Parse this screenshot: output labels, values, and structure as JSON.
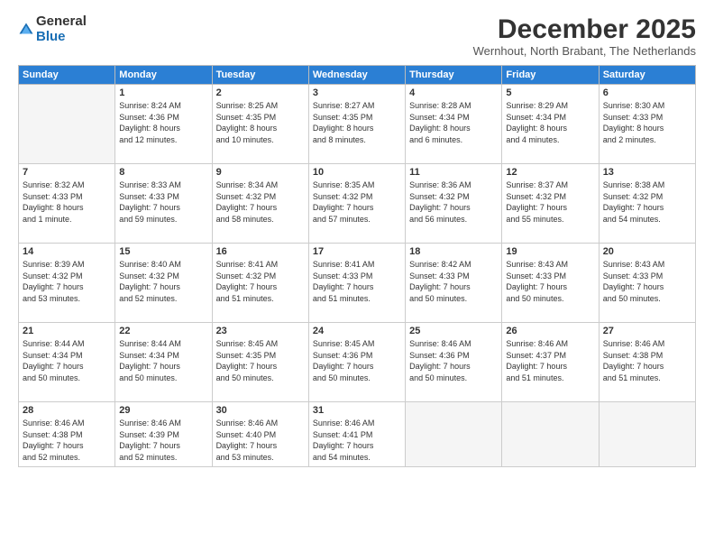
{
  "logo": {
    "general": "General",
    "blue": "Blue"
  },
  "title": "December 2025",
  "location": "Wernhout, North Brabant, The Netherlands",
  "headers": [
    "Sunday",
    "Monday",
    "Tuesday",
    "Wednesday",
    "Thursday",
    "Friday",
    "Saturday"
  ],
  "weeks": [
    [
      {
        "day": "",
        "info": ""
      },
      {
        "day": "1",
        "info": "Sunrise: 8:24 AM\nSunset: 4:36 PM\nDaylight: 8 hours\nand 12 minutes."
      },
      {
        "day": "2",
        "info": "Sunrise: 8:25 AM\nSunset: 4:35 PM\nDaylight: 8 hours\nand 10 minutes."
      },
      {
        "day": "3",
        "info": "Sunrise: 8:27 AM\nSunset: 4:35 PM\nDaylight: 8 hours\nand 8 minutes."
      },
      {
        "day": "4",
        "info": "Sunrise: 8:28 AM\nSunset: 4:34 PM\nDaylight: 8 hours\nand 6 minutes."
      },
      {
        "day": "5",
        "info": "Sunrise: 8:29 AM\nSunset: 4:34 PM\nDaylight: 8 hours\nand 4 minutes."
      },
      {
        "day": "6",
        "info": "Sunrise: 8:30 AM\nSunset: 4:33 PM\nDaylight: 8 hours\nand 2 minutes."
      }
    ],
    [
      {
        "day": "7",
        "info": "Sunrise: 8:32 AM\nSunset: 4:33 PM\nDaylight: 8 hours\nand 1 minute."
      },
      {
        "day": "8",
        "info": "Sunrise: 8:33 AM\nSunset: 4:33 PM\nDaylight: 7 hours\nand 59 minutes."
      },
      {
        "day": "9",
        "info": "Sunrise: 8:34 AM\nSunset: 4:32 PM\nDaylight: 7 hours\nand 58 minutes."
      },
      {
        "day": "10",
        "info": "Sunrise: 8:35 AM\nSunset: 4:32 PM\nDaylight: 7 hours\nand 57 minutes."
      },
      {
        "day": "11",
        "info": "Sunrise: 8:36 AM\nSunset: 4:32 PM\nDaylight: 7 hours\nand 56 minutes."
      },
      {
        "day": "12",
        "info": "Sunrise: 8:37 AM\nSunset: 4:32 PM\nDaylight: 7 hours\nand 55 minutes."
      },
      {
        "day": "13",
        "info": "Sunrise: 8:38 AM\nSunset: 4:32 PM\nDaylight: 7 hours\nand 54 minutes."
      }
    ],
    [
      {
        "day": "14",
        "info": "Sunrise: 8:39 AM\nSunset: 4:32 PM\nDaylight: 7 hours\nand 53 minutes."
      },
      {
        "day": "15",
        "info": "Sunrise: 8:40 AM\nSunset: 4:32 PM\nDaylight: 7 hours\nand 52 minutes."
      },
      {
        "day": "16",
        "info": "Sunrise: 8:41 AM\nSunset: 4:32 PM\nDaylight: 7 hours\nand 51 minutes."
      },
      {
        "day": "17",
        "info": "Sunrise: 8:41 AM\nSunset: 4:33 PM\nDaylight: 7 hours\nand 51 minutes."
      },
      {
        "day": "18",
        "info": "Sunrise: 8:42 AM\nSunset: 4:33 PM\nDaylight: 7 hours\nand 50 minutes."
      },
      {
        "day": "19",
        "info": "Sunrise: 8:43 AM\nSunset: 4:33 PM\nDaylight: 7 hours\nand 50 minutes."
      },
      {
        "day": "20",
        "info": "Sunrise: 8:43 AM\nSunset: 4:33 PM\nDaylight: 7 hours\nand 50 minutes."
      }
    ],
    [
      {
        "day": "21",
        "info": "Sunrise: 8:44 AM\nSunset: 4:34 PM\nDaylight: 7 hours\nand 50 minutes."
      },
      {
        "day": "22",
        "info": "Sunrise: 8:44 AM\nSunset: 4:34 PM\nDaylight: 7 hours\nand 50 minutes."
      },
      {
        "day": "23",
        "info": "Sunrise: 8:45 AM\nSunset: 4:35 PM\nDaylight: 7 hours\nand 50 minutes."
      },
      {
        "day": "24",
        "info": "Sunrise: 8:45 AM\nSunset: 4:36 PM\nDaylight: 7 hours\nand 50 minutes."
      },
      {
        "day": "25",
        "info": "Sunrise: 8:46 AM\nSunset: 4:36 PM\nDaylight: 7 hours\nand 50 minutes."
      },
      {
        "day": "26",
        "info": "Sunrise: 8:46 AM\nSunset: 4:37 PM\nDaylight: 7 hours\nand 51 minutes."
      },
      {
        "day": "27",
        "info": "Sunrise: 8:46 AM\nSunset: 4:38 PM\nDaylight: 7 hours\nand 51 minutes."
      }
    ],
    [
      {
        "day": "28",
        "info": "Sunrise: 8:46 AM\nSunset: 4:38 PM\nDaylight: 7 hours\nand 52 minutes."
      },
      {
        "day": "29",
        "info": "Sunrise: 8:46 AM\nSunset: 4:39 PM\nDaylight: 7 hours\nand 52 minutes."
      },
      {
        "day": "30",
        "info": "Sunrise: 8:46 AM\nSunset: 4:40 PM\nDaylight: 7 hours\nand 53 minutes."
      },
      {
        "day": "31",
        "info": "Sunrise: 8:46 AM\nSunset: 4:41 PM\nDaylight: 7 hours\nand 54 minutes."
      },
      {
        "day": "",
        "info": ""
      },
      {
        "day": "",
        "info": ""
      },
      {
        "day": "",
        "info": ""
      }
    ]
  ]
}
